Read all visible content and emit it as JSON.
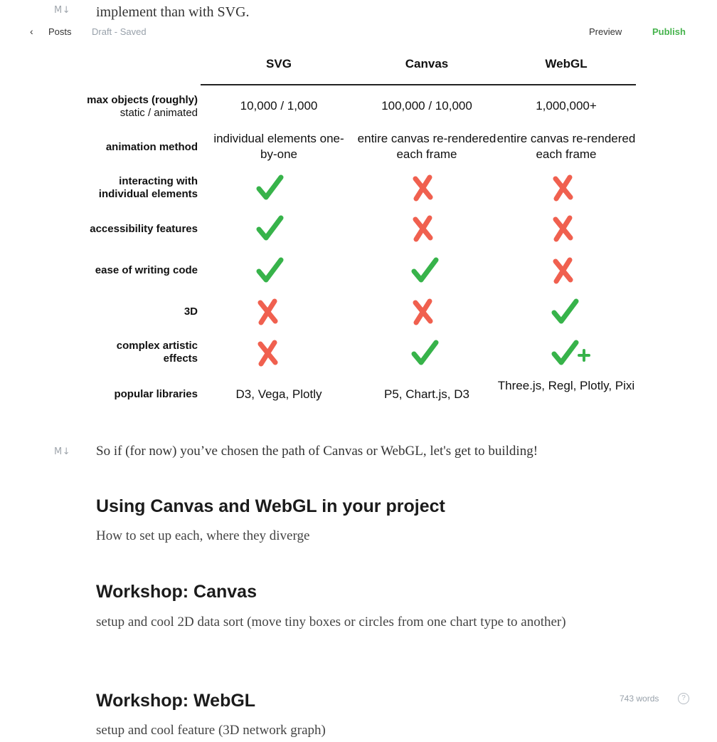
{
  "top_clip_text": "implement than with SVG.",
  "md_badge": "M↓",
  "nav": {
    "back_icon": "chevron-left-icon",
    "posts": "Posts",
    "status": "Draft - Saved",
    "preview": "Preview",
    "publish": "Publish"
  },
  "table": {
    "columns": [
      "SVG",
      "Canvas",
      "WebGL"
    ],
    "rows": [
      {
        "label": "max objects (roughly)",
        "sublabel": "static / animated",
        "cells": [
          "10,000 / 1,000",
          "100,000 / 10,000",
          "1,000,000+"
        ]
      },
      {
        "label": "animation method",
        "cells": [
          "individual elements one-by-one",
          "entire canvas re-rendered each frame",
          "entire canvas re-rendered each frame"
        ]
      },
      {
        "label": "interacting with individual elements",
        "marks": [
          "check",
          "cross",
          "cross"
        ]
      },
      {
        "label": "accessibility features",
        "marks": [
          "check",
          "cross",
          "cross"
        ]
      },
      {
        "label": "ease of writing code",
        "marks": [
          "check",
          "check",
          "cross"
        ]
      },
      {
        "label": "3D",
        "marks": [
          "cross",
          "cross",
          "check"
        ]
      },
      {
        "label": "complex artistic effects",
        "marks": [
          "cross",
          "check",
          "check-plus"
        ]
      },
      {
        "label": "popular libraries",
        "cells": [
          "D3, Vega, Plotly",
          "P5, Chart.js, D3",
          "Three.js, Regl, Plotly, Pixi"
        ]
      }
    ]
  },
  "paragraph": "So if (for now) you’ve chosen the path of Canvas or WebGL, let's get to building!",
  "sections": [
    {
      "heading": "Using Canvas and WebGL in your project",
      "subtext": "How to set up each, where they diverge"
    },
    {
      "heading": "Workshop: Canvas",
      "subtext": "setup and cool 2D data sort (move tiny boxes or circles from one chart type to another)"
    },
    {
      "heading": "Workshop: WebGL",
      "subtext": "setup and cool feature (3D network graph)"
    }
  ],
  "footer": {
    "word_count": "743 words",
    "help_label": "?"
  },
  "colors": {
    "check": "#37b34a",
    "cross": "#f0604f",
    "publish": "#46b34d"
  }
}
